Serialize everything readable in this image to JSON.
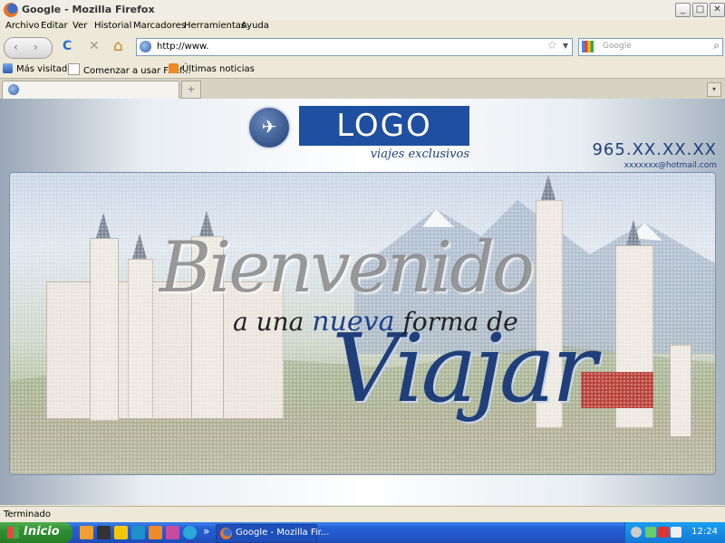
{
  "window": {
    "title": "Google - Mozilla Firefox",
    "min": "_",
    "max": "□",
    "close": "✕"
  },
  "menu": [
    "Archivo",
    "Editar",
    "Ver",
    "Historial",
    "Marcadores",
    "Herramientas",
    "Ayuda"
  ],
  "nav": {
    "back": "‹",
    "fwd": "›",
    "reload": "C",
    "stop": "✕",
    "home": "⌂",
    "url": "http://www.",
    "star": "☆",
    "search_placeholder": "Google",
    "search_icon": "⌕"
  },
  "bookmarks": [
    "Más visitados",
    "Comenzar a usar Firef...",
    "Últimas noticias"
  ],
  "tabs": {
    "new_tab": "+",
    "list": "▾"
  },
  "site": {
    "logo_text": "LOGO",
    "emblem": "✈",
    "tagline": "viajes exclusivos",
    "phone": "965.XX.XX.XX",
    "email": "xxxxxxx@hotmail.com",
    "hero_word": "Bienvenido",
    "hero_line_a": "a una ",
    "hero_line_b": "nueva",
    "hero_line_c": " forma de",
    "hero_word2": "Viajar"
  },
  "status": "Terminado",
  "taskbar": {
    "start": "Inicio",
    "task": "Google - Mozilla Fir...",
    "clock": "12:24",
    "more": "»"
  }
}
